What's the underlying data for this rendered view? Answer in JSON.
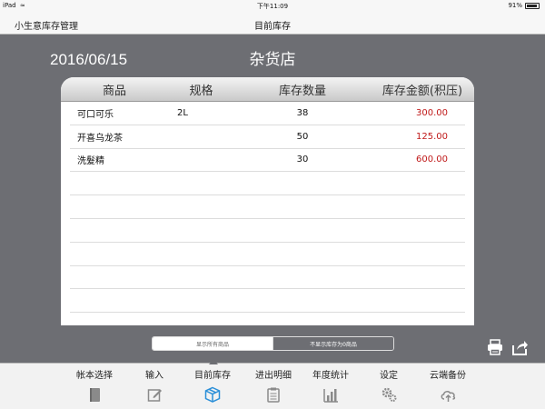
{
  "status_bar": {
    "device": "iPad",
    "time": "下午11:09",
    "battery": "91%",
    "battery_level": 0.91
  },
  "nav": {
    "back_label": "小生意库存管理",
    "title": "目前库存"
  },
  "header": {
    "date": "2016/06/15",
    "store_name": "杂货店"
  },
  "table": {
    "columns": [
      "商品",
      "规格",
      "库存数量",
      "库存金额(积压)"
    ],
    "rows": [
      {
        "name": "可口可乐",
        "spec": "2L",
        "qty": "38",
        "amount": "300.00"
      },
      {
        "name": "开喜乌龙茶",
        "spec": "",
        "qty": "50",
        "amount": "125.00"
      },
      {
        "name": "洗髮精",
        "spec": "",
        "qty": "30",
        "amount": "600.00"
      },
      {
        "name": "",
        "spec": "",
        "qty": "",
        "amount": ""
      },
      {
        "name": "",
        "spec": "",
        "qty": "",
        "amount": ""
      },
      {
        "name": "",
        "spec": "",
        "qty": "",
        "amount": ""
      },
      {
        "name": "",
        "spec": "",
        "qty": "",
        "amount": ""
      },
      {
        "name": "",
        "spec": "",
        "qty": "",
        "amount": ""
      },
      {
        "name": "",
        "spec": "",
        "qty": "",
        "amount": ""
      }
    ]
  },
  "filter": {
    "show_all": "显示所有商品",
    "hide_zero": "不显示库存为0商品",
    "selected": "show_all"
  },
  "actions": {
    "print_icon": "printer-icon",
    "share_icon": "share-icon"
  },
  "tabs": [
    {
      "label": "帐本选择",
      "icon": "book-icon",
      "active": false
    },
    {
      "label": "输入",
      "icon": "edit-icon",
      "active": false
    },
    {
      "label": "目前库存",
      "icon": "box-icon",
      "active": true
    },
    {
      "label": "进出明细",
      "icon": "clipboard-icon",
      "active": false
    },
    {
      "label": "年度统计",
      "icon": "bar-chart-icon",
      "active": false
    },
    {
      "label": "设定",
      "icon": "gears-icon",
      "active": false
    },
    {
      "label": "云端备份",
      "icon": "cloud-upload-icon",
      "active": false
    }
  ],
  "colors": {
    "accent": "#2a8fd8",
    "amount_red": "#c01a1a",
    "background": "#6d6e73",
    "icon_gray": "#8a8a8a"
  }
}
